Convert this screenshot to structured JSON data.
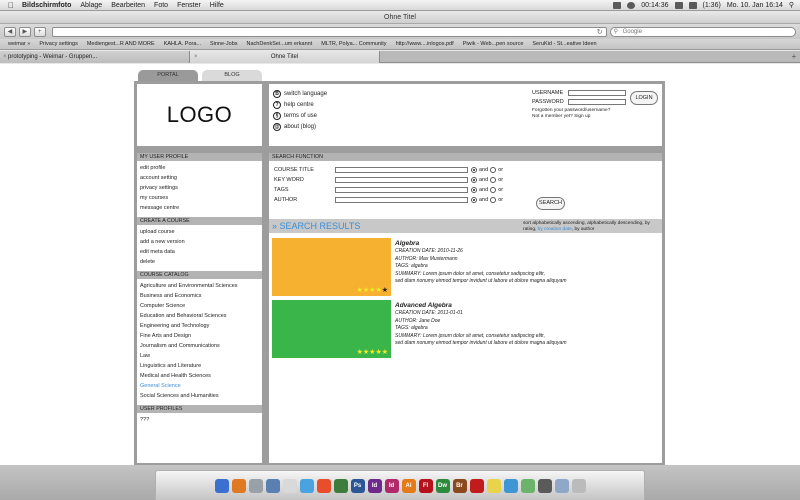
{
  "menubar": {
    "app": "Bildschirmfoto",
    "items": [
      "Ablage",
      "Bearbeiten",
      "Foto",
      "Fenster",
      "Hilfe"
    ],
    "clock": "00:14:36",
    "battery": "(1:36)",
    "datetime": "Mo. 10. Jan  16:14"
  },
  "window": {
    "title": "Ohne Titel",
    "search_placeholder": "Google"
  },
  "bookmarks": [
    "weimar »",
    "Privacy settings",
    "Mediengest...R AND MORE",
    "KAHLA. Pora...",
    "Sinne-Jobs",
    "NachDenkSei...um erkannt",
    "MLTR, Polya... Community",
    "http://www....inlogos.pdf",
    "Piwik - Web...pen source",
    "SeruKid - St...eative Ideen"
  ],
  "browser_tabs": [
    "prototyping - Weimar - Gruppen...",
    "Ohne Titel"
  ],
  "site": {
    "tabs": [
      "PORTAL",
      "BLOG"
    ],
    "logo": "LOGO",
    "header_links": [
      {
        "icon": "B",
        "label": "switch language"
      },
      {
        "icon": "?",
        "label": "help centre"
      },
      {
        "icon": "§",
        "label": "terms of use"
      },
      {
        "icon": "@",
        "label": "about (blog)"
      }
    ],
    "login": {
      "username_label": "USERNAME",
      "password_label": "PASSWORD",
      "button": "LOGIN",
      "forgot": "Forgotten your password/username?",
      "signup": "Not a member yet? Sign up"
    },
    "sidebar": {
      "profile_head": "MY USER PROFILE",
      "profile_items": [
        "edit profile",
        "account setting",
        "privacy settings",
        "my courses",
        "message centre"
      ],
      "course_head": "CREATE A COURSE",
      "course_items": [
        "upload course",
        "add a new version",
        "edit meta data",
        "delete"
      ],
      "catalog_head": "COURSE CATALOG",
      "catalog_items": [
        "Agriculture and Environmental Sciences",
        "Business and Economics",
        "Computer Science",
        "Education and Behavioral Sciences",
        "Engineering and Technology",
        "Fine Arts and Design",
        "Journalism and Communications",
        "Law",
        "Linguistics and Literature",
        "Medical and Health Sciences",
        "General Science",
        "Social Sciences and Humanities"
      ],
      "catalog_selected": "General Science",
      "profiles_head": "USER PROFILES",
      "profiles_text": "???"
    },
    "search": {
      "head": "SEARCH FUNCTION",
      "fields": [
        "COURSE TITLE",
        "KEY WORD",
        "TAGS",
        "AUTHOR"
      ],
      "and_label": "and",
      "or_label": "or",
      "button": "SEARCH"
    },
    "results": {
      "title": "» SEARCH RESULTS",
      "sort_prefix": "sort alphabetically ascending, alphabetically descending, by rating, ",
      "sort_highlight": "by creation date",
      "sort_suffix": ", by author",
      "items": [
        {
          "title": "Algebra",
          "creation": "CREATION DATE: 2010-11-26",
          "author": "AUTHOR: Max Mustermann",
          "tags": "TAGS: algebra",
          "summary1": "SUMMARY: Lorem ipsum dolor sit amet, consetetur sadipscing elitr,",
          "summary2": "sed diam nonumy eirmod tempor invidunt ut labore et dolore magna aliquyam",
          "color": "#f5b12f",
          "rating": 4
        },
        {
          "title": "Advanced Algebra",
          "creation": "CREATION DATE: 2011-01-01",
          "author": "AUTHOR: Jane Doe",
          "tags": "TAGS: algebra",
          "summary1": "SUMMARY: Lorem ipsum dolor sit amet, consetetur sadipscing elitr,",
          "summary2": "sed diam nonumy eirmod tempor invidunt ut labore et dolore magna aliquyam",
          "color": "#3ab54a",
          "rating": 5
        }
      ]
    }
  }
}
